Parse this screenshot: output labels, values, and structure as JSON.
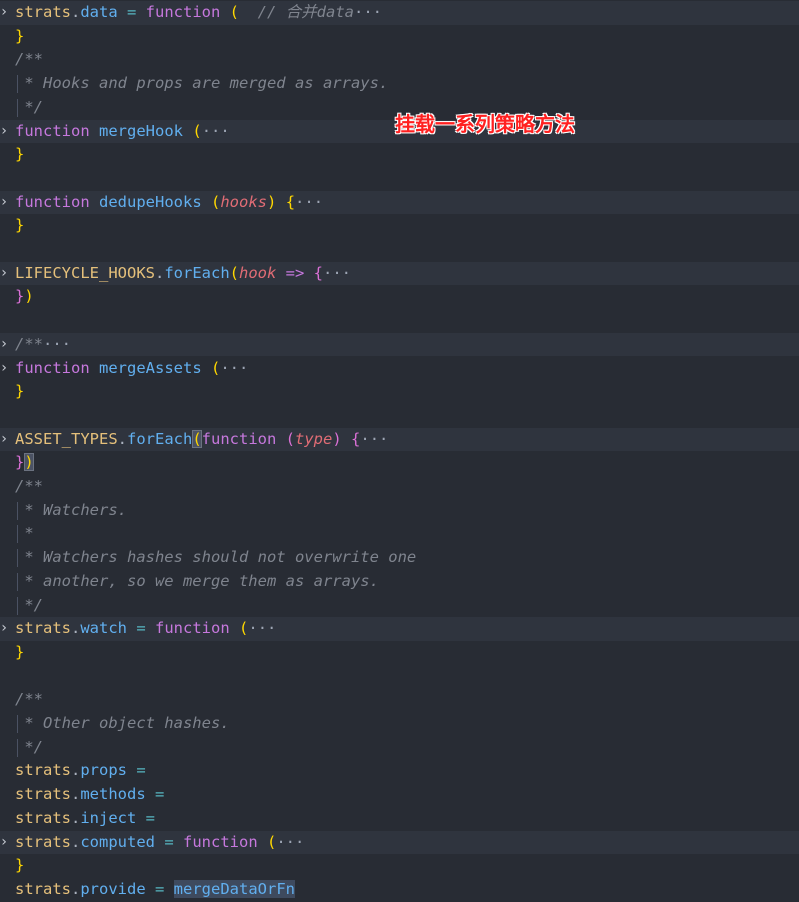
{
  "annotation": "挂载一系列策略方法",
  "lines": [
    {
      "fold": true,
      "hl": true,
      "tokens": [
        {
          "t": "strats",
          "c": "obj"
        },
        {
          "t": ".",
          "c": "plain"
        },
        {
          "t": "data",
          "c": "prop"
        },
        {
          "t": " = ",
          "c": "op"
        },
        {
          "t": "function",
          "c": "kw"
        },
        {
          "t": " ",
          "c": "plain"
        },
        {
          "t": "(",
          "c": "brace"
        },
        {
          "t": "  // 合并data",
          "c": "comment"
        },
        {
          "t": "···",
          "c": "ellipsis"
        }
      ]
    },
    {
      "tokens": [
        {
          "t": "}",
          "c": "brace"
        }
      ]
    },
    {
      "tokens": [
        {
          "t": "/**",
          "c": "comment"
        }
      ]
    },
    {
      "guide": true,
      "tokens": [
        {
          "t": " * Hooks and props are merged as arrays.",
          "c": "comment"
        }
      ]
    },
    {
      "guide": true,
      "tokens": [
        {
          "t": " */",
          "c": "comment"
        }
      ]
    },
    {
      "fold": true,
      "hl": true,
      "tokens": [
        {
          "t": "function",
          "c": "kw"
        },
        {
          "t": " ",
          "c": "plain"
        },
        {
          "t": "mergeHook",
          "c": "fn"
        },
        {
          "t": " ",
          "c": "plain"
        },
        {
          "t": "(",
          "c": "brace"
        },
        {
          "t": "···",
          "c": "ellipsis"
        }
      ]
    },
    {
      "tokens": [
        {
          "t": "}",
          "c": "brace"
        }
      ]
    },
    {
      "tokens": []
    },
    {
      "fold": true,
      "hl": true,
      "tokens": [
        {
          "t": "function",
          "c": "kw"
        },
        {
          "t": " ",
          "c": "plain"
        },
        {
          "t": "dedupeHooks",
          "c": "fn"
        },
        {
          "t": " ",
          "c": "plain"
        },
        {
          "t": "(",
          "c": "brace"
        },
        {
          "t": "hooks",
          "c": "param"
        },
        {
          "t": ")",
          "c": "brace"
        },
        {
          "t": " ",
          "c": "plain"
        },
        {
          "t": "{",
          "c": "brace"
        },
        {
          "t": "···",
          "c": "ellipsis"
        }
      ]
    },
    {
      "tokens": [
        {
          "t": "}",
          "c": "brace"
        }
      ]
    },
    {
      "tokens": []
    },
    {
      "fold": true,
      "hl": true,
      "tokens": [
        {
          "t": "LIFECYCLE_HOOKS",
          "c": "obj"
        },
        {
          "t": ".",
          "c": "plain"
        },
        {
          "t": "forEach",
          "c": "fn"
        },
        {
          "t": "(",
          "c": "brace"
        },
        {
          "t": "hook",
          "c": "param"
        },
        {
          "t": " => ",
          "c": "kw"
        },
        {
          "t": "{",
          "c": "brace2"
        },
        {
          "t": "···",
          "c": "ellipsis"
        }
      ]
    },
    {
      "tokens": [
        {
          "t": "}",
          "c": "brace2"
        },
        {
          "t": ")",
          "c": "brace"
        }
      ]
    },
    {
      "tokens": []
    },
    {
      "fold": true,
      "hl": true,
      "tokens": [
        {
          "t": "/**",
          "c": "comment"
        },
        {
          "t": "···",
          "c": "ellipsis"
        }
      ]
    },
    {
      "fold": true,
      "tokens": [
        {
          "t": "function",
          "c": "kw"
        },
        {
          "t": " ",
          "c": "plain"
        },
        {
          "t": "mergeAssets",
          "c": "fn"
        },
        {
          "t": " ",
          "c": "plain"
        },
        {
          "t": "(",
          "c": "brace"
        },
        {
          "t": "···",
          "c": "ellipsis"
        }
      ]
    },
    {
      "tokens": [
        {
          "t": "}",
          "c": "brace"
        }
      ]
    },
    {
      "tokens": []
    },
    {
      "fold": true,
      "hl": true,
      "tokens": [
        {
          "t": "ASSET_TYPES",
          "c": "obj"
        },
        {
          "t": ".",
          "c": "plain"
        },
        {
          "t": "forEach",
          "c": "fn"
        },
        {
          "t": "(",
          "c": "brace match"
        },
        {
          "t": "function",
          "c": "kw"
        },
        {
          "t": " ",
          "c": "plain"
        },
        {
          "t": "(",
          "c": "brace2"
        },
        {
          "t": "type",
          "c": "param"
        },
        {
          "t": ")",
          "c": "brace2"
        },
        {
          "t": " ",
          "c": "plain"
        },
        {
          "t": "{",
          "c": "brace2"
        },
        {
          "t": "···",
          "c": "ellipsis"
        }
      ]
    },
    {
      "tokens": [
        {
          "t": "}",
          "c": "brace2"
        },
        {
          "t": ")",
          "c": "brace match"
        }
      ]
    },
    {
      "tokens": [
        {
          "t": "/**",
          "c": "comment"
        }
      ]
    },
    {
      "guide": true,
      "tokens": [
        {
          "t": " * Watchers.",
          "c": "comment"
        }
      ]
    },
    {
      "guide": true,
      "tokens": [
        {
          "t": " *",
          "c": "comment"
        }
      ]
    },
    {
      "guide": true,
      "tokens": [
        {
          "t": " * Watchers hashes should not overwrite one",
          "c": "comment"
        }
      ]
    },
    {
      "guide": true,
      "tokens": [
        {
          "t": " * another, so we merge them as arrays.",
          "c": "comment"
        }
      ]
    },
    {
      "guide": true,
      "tokens": [
        {
          "t": " */",
          "c": "comment"
        }
      ]
    },
    {
      "fold": true,
      "hl": true,
      "tokens": [
        {
          "t": "strats",
          "c": "obj"
        },
        {
          "t": ".",
          "c": "plain"
        },
        {
          "t": "watch",
          "c": "prop"
        },
        {
          "t": " = ",
          "c": "op"
        },
        {
          "t": "function",
          "c": "kw"
        },
        {
          "t": " ",
          "c": "plain"
        },
        {
          "t": "(",
          "c": "brace"
        },
        {
          "t": "···",
          "c": "ellipsis"
        }
      ]
    },
    {
      "tokens": [
        {
          "t": "}",
          "c": "brace"
        }
      ]
    },
    {
      "tokens": []
    },
    {
      "tokens": [
        {
          "t": "/**",
          "c": "comment"
        }
      ]
    },
    {
      "guide": true,
      "tokens": [
        {
          "t": " * Other object hashes.",
          "c": "comment"
        }
      ]
    },
    {
      "guide": true,
      "tokens": [
        {
          "t": " */",
          "c": "comment"
        }
      ]
    },
    {
      "tokens": [
        {
          "t": "strats",
          "c": "obj"
        },
        {
          "t": ".",
          "c": "plain"
        },
        {
          "t": "props",
          "c": "prop"
        },
        {
          "t": " =",
          "c": "op"
        }
      ]
    },
    {
      "tokens": [
        {
          "t": "strats",
          "c": "obj"
        },
        {
          "t": ".",
          "c": "plain"
        },
        {
          "t": "methods",
          "c": "prop"
        },
        {
          "t": " =",
          "c": "op"
        }
      ]
    },
    {
      "tokens": [
        {
          "t": "strats",
          "c": "obj"
        },
        {
          "t": ".",
          "c": "plain"
        },
        {
          "t": "inject",
          "c": "prop"
        },
        {
          "t": " =",
          "c": "op"
        }
      ]
    },
    {
      "fold": true,
      "hl": true,
      "tokens": [
        {
          "t": "strats",
          "c": "obj"
        },
        {
          "t": ".",
          "c": "plain"
        },
        {
          "t": "computed",
          "c": "prop"
        },
        {
          "t": " = ",
          "c": "op"
        },
        {
          "t": "function",
          "c": "kw"
        },
        {
          "t": " ",
          "c": "plain"
        },
        {
          "t": "(",
          "c": "brace"
        },
        {
          "t": "···",
          "c": "ellipsis"
        }
      ]
    },
    {
      "tokens": [
        {
          "t": "}",
          "c": "brace"
        }
      ]
    },
    {
      "tokens": [
        {
          "t": "strats",
          "c": "obj"
        },
        {
          "t": ".",
          "c": "plain"
        },
        {
          "t": "provide",
          "c": "prop"
        },
        {
          "t": " = ",
          "c": "op"
        },
        {
          "t": "mergeDataOrFn",
          "c": "fn sel"
        }
      ]
    }
  ]
}
